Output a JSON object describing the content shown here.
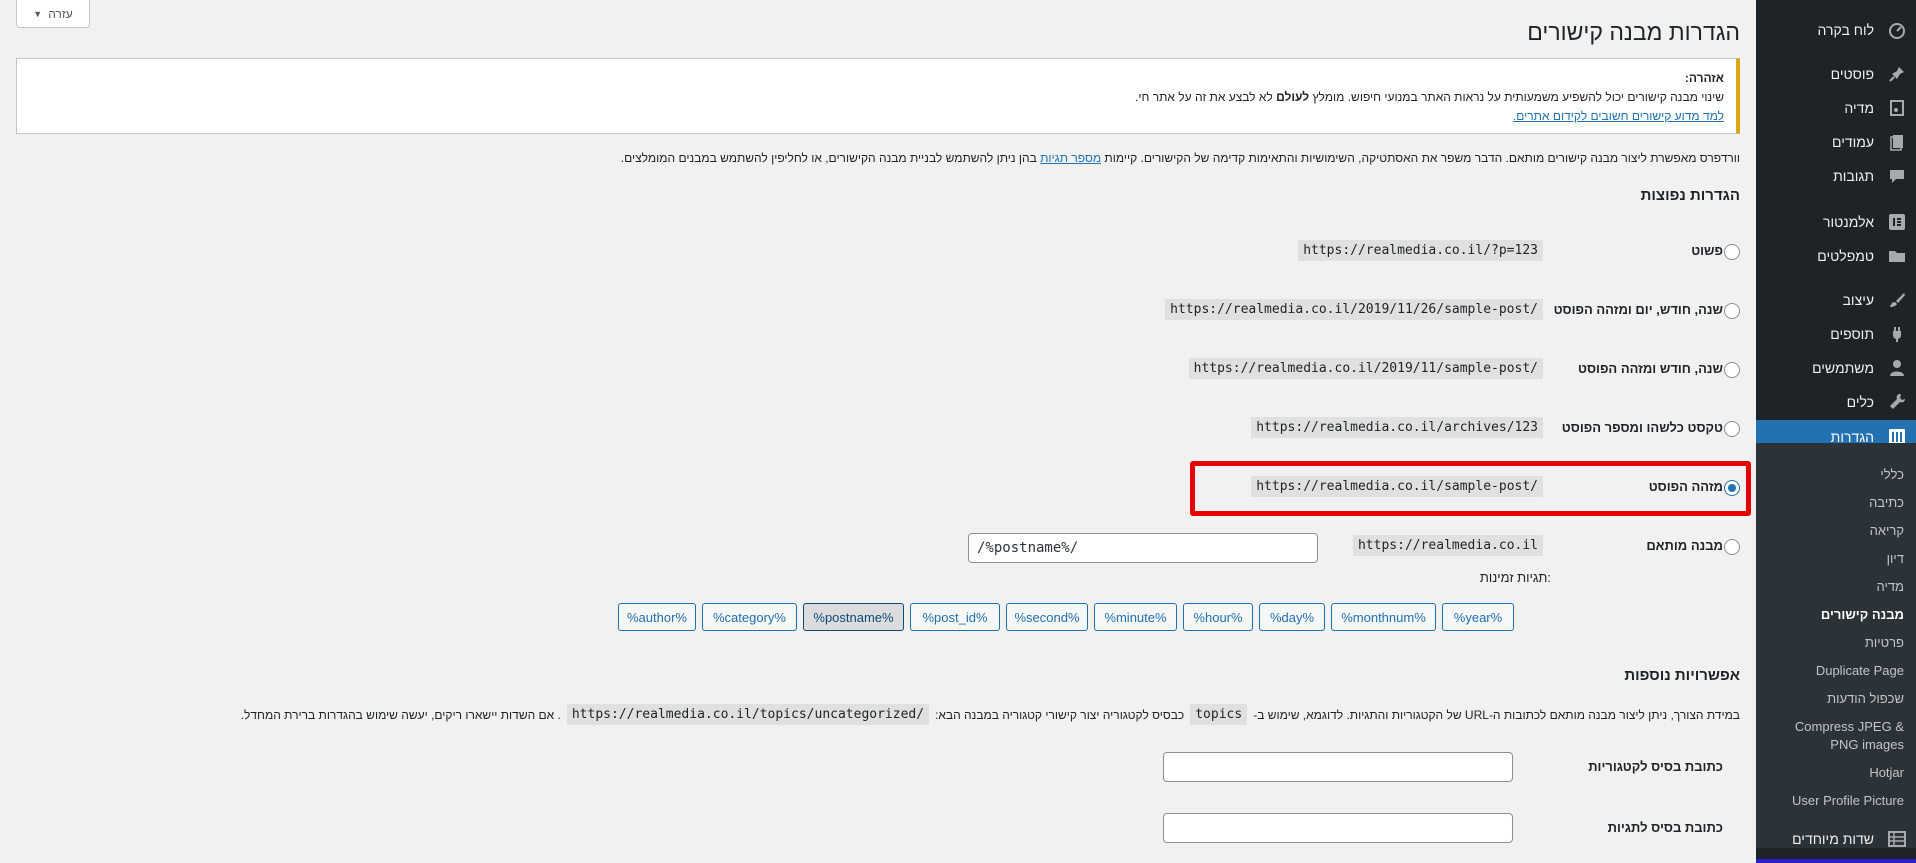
{
  "sidebar": {
    "items": [
      {
        "label": "לוח בקרה",
        "icon": "dashboard-icon"
      },
      {
        "label": "פוסטים",
        "icon": "pin-icon"
      },
      {
        "label": "מדיה",
        "icon": "media-icon"
      },
      {
        "label": "עמודים",
        "icon": "pages-icon"
      },
      {
        "label": "תגובות",
        "icon": "comments-icon"
      },
      {
        "label": "אלמנטור",
        "icon": "elementor-icon"
      },
      {
        "label": "טמפלטים",
        "icon": "folder-icon"
      },
      {
        "label": "עיצוב",
        "icon": "brush-icon"
      },
      {
        "label": "תוספים",
        "icon": "plugin-icon"
      },
      {
        "label": "משתמשים",
        "icon": "users-icon"
      },
      {
        "label": "כלים",
        "icon": "wrench-icon"
      },
      {
        "label": "הגדרות",
        "icon": "settings-icon"
      }
    ],
    "submenu": [
      "כללי",
      "כתיבה",
      "קריאה",
      "דיון",
      "מדיה",
      "מבנה קישורים",
      "פרטיות",
      "Duplicate Page",
      "שכפול הודעות",
      "Compress JPEG &",
      "PNG images",
      "Hotjar",
      "User Profile Picture"
    ],
    "last_item": {
      "label": "שדות מיוחדים",
      "icon": "grid-icon"
    }
  },
  "help_label": "עזרה",
  "page_title": "הגדרות מבנה קישורים",
  "notice": {
    "title": "אזהרה:",
    "line1_a": "שינוי מבנה קישורים יכול להשפיע משמעותית על נראות האתר במנועי חיפוש. מומלץ",
    "line1_bold": "לעולם",
    "line1_b": "לא לבצע את זה על אתר חי.",
    "link": "למד מדוע קישורים חשובים לקידום אתרים."
  },
  "intro": {
    "a": "וורדפרס מאפשרת ליצור מבנה קישורים מותאם. הדבר משפר את האסתטיקה, השימושיות והתאימות קדימה של הקישורים. קיימות",
    "link": "מספר תגיות",
    "b": "בהן ניתן להשתמש לבניית מבנה הקישורים, או לחליפין להשתמש במבנים המומלצים."
  },
  "common_heading": "הגדרות נפוצות",
  "options": [
    {
      "label": "פשוט",
      "example": "https://realmedia.co.il/?p=123",
      "checked": false
    },
    {
      "label": "שנה, חודש, יום ומזהה הפוסט",
      "example": "https://realmedia.co.il/2019/11/26/sample-post/",
      "checked": false
    },
    {
      "label": "שנה, חודש ומזהה הפוסט",
      "example": "https://realmedia.co.il/2019/11/sample-post/",
      "checked": false
    },
    {
      "label": "טקסט כלשהו ומספר הפוסט",
      "example": "https://realmedia.co.il/archives/123",
      "checked": false
    },
    {
      "label": "מזהה הפוסט",
      "example": "https://realmedia.co.il/sample-post/",
      "checked": true
    }
  ],
  "custom": {
    "label": "מבנה מותאם",
    "prefix": "https://realmedia.co.il",
    "value": "/%postname%/",
    "tags_label": "תגיות זמינות:",
    "tags": [
      "%year%",
      "%monthnum%",
      "%day%",
      "%hour%",
      "%minute%",
      "%second%",
      "%post_id%",
      "%postname%",
      "%category%",
      "%author%"
    ],
    "pressed_tag": "%postname%"
  },
  "optional_heading": "אפשרויות נוספות",
  "optional_desc": {
    "a": "במידת הצורך, ניתן ליצור מבנה מותאם לכתובות ה-URL של הקטגוריות והתגיות. לדוגמא, שימוש ב-",
    "code1": "topics",
    "b": "כבסיס לקטגוריה יצור קישורי קטגוריה במבנה הבא:",
    "code2": "https://realmedia.co.il/topics/uncategorized/",
    "c": ". אם השדות יישארו ריקים, יעשה שימוש בהגדרות ברירת המחדל."
  },
  "category_base_label": "כתובת בסיס לקטגוריות",
  "tag_base_label": "כתובת בסיס לתגיות"
}
